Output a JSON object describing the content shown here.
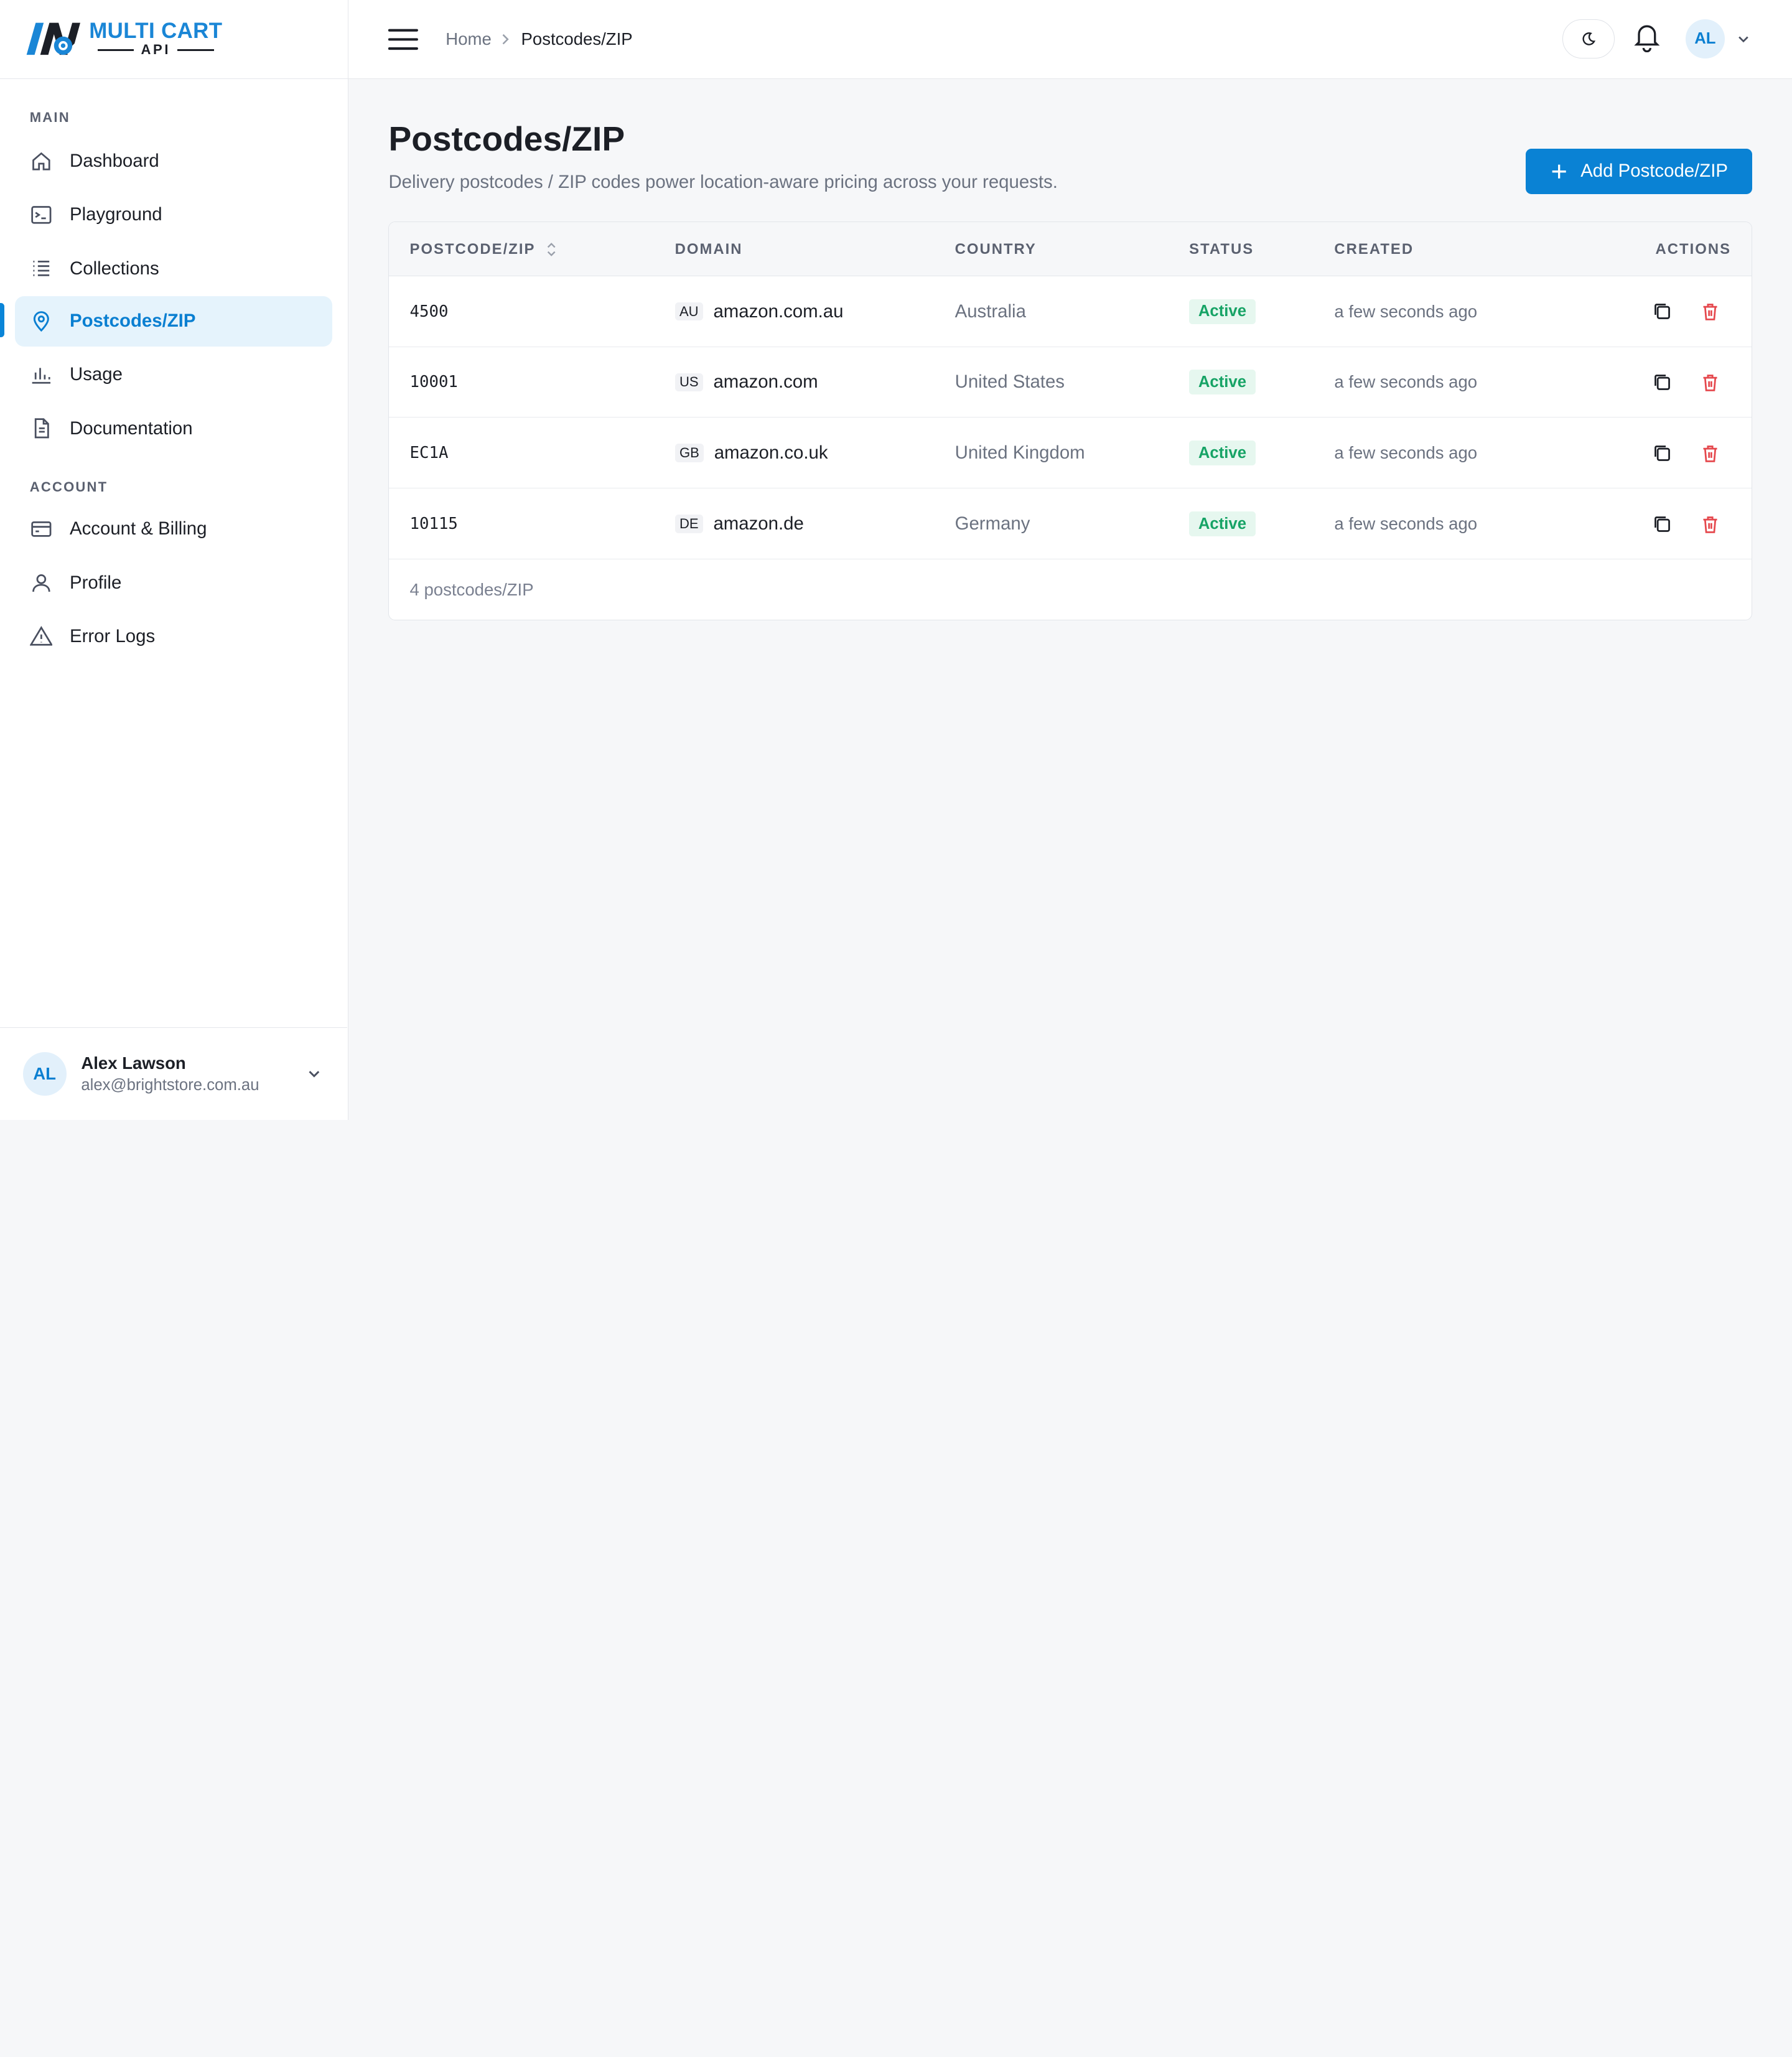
{
  "logo": {
    "line1": "MULTI CART",
    "line2": "API"
  },
  "sidebar": {
    "main_label": "MAIN",
    "account_label": "ACCOUNT",
    "main_items": [
      {
        "label": "Dashboard",
        "icon": "home-icon"
      },
      {
        "label": "Playground",
        "icon": "terminal-icon"
      },
      {
        "label": "Collections",
        "icon": "list-icon"
      },
      {
        "label": "Postcodes/ZIP",
        "icon": "map-pin-icon",
        "active": true
      },
      {
        "label": "Usage",
        "icon": "bar-chart-icon"
      },
      {
        "label": "Documentation",
        "icon": "document-icon"
      }
    ],
    "account_items": [
      {
        "label": "Account & Billing",
        "icon": "credit-card-icon"
      },
      {
        "label": "Profile",
        "icon": "user-icon"
      },
      {
        "label": "Error Logs",
        "icon": "warning-icon"
      }
    ],
    "user": {
      "initials": "AL",
      "name": "Alex Lawson",
      "email": "alex@brightstore.com.au"
    }
  },
  "topbar": {
    "breadcrumb_home": "Home",
    "breadcrumb_current": "Postcodes/ZIP",
    "avatar_initials": "AL"
  },
  "page": {
    "title": "Postcodes/ZIP",
    "subtitle": "Delivery postcodes / ZIP codes power location-aware pricing across your requests.",
    "add_button": "Add Postcode/ZIP"
  },
  "table": {
    "headers": {
      "postcode": "POSTCODE/ZIP",
      "domain": "DOMAIN",
      "country": "COUNTRY",
      "status": "STATUS",
      "created": "CREATED",
      "actions": "ACTIONS"
    },
    "rows": [
      {
        "postcode": "4500",
        "cc": "AU",
        "domain": "amazon.com.au",
        "country": "Australia",
        "status": "Active",
        "created": "a few seconds ago"
      },
      {
        "postcode": "10001",
        "cc": "US",
        "domain": "amazon.com",
        "country": "United States",
        "status": "Active",
        "created": "a few seconds ago"
      },
      {
        "postcode": "EC1A",
        "cc": "GB",
        "domain": "amazon.co.uk",
        "country": "United Kingdom",
        "status": "Active",
        "created": "a few seconds ago"
      },
      {
        "postcode": "10115",
        "cc": "DE",
        "domain": "amazon.de",
        "country": "Germany",
        "status": "Active",
        "created": "a few seconds ago"
      }
    ],
    "footer": "4 postcodes/ZIP"
  },
  "colors": {
    "accent": "#0a82d4",
    "active_bg": "#e5f3fc",
    "status_green": "#16a365",
    "delete_red": "#e5484d"
  }
}
